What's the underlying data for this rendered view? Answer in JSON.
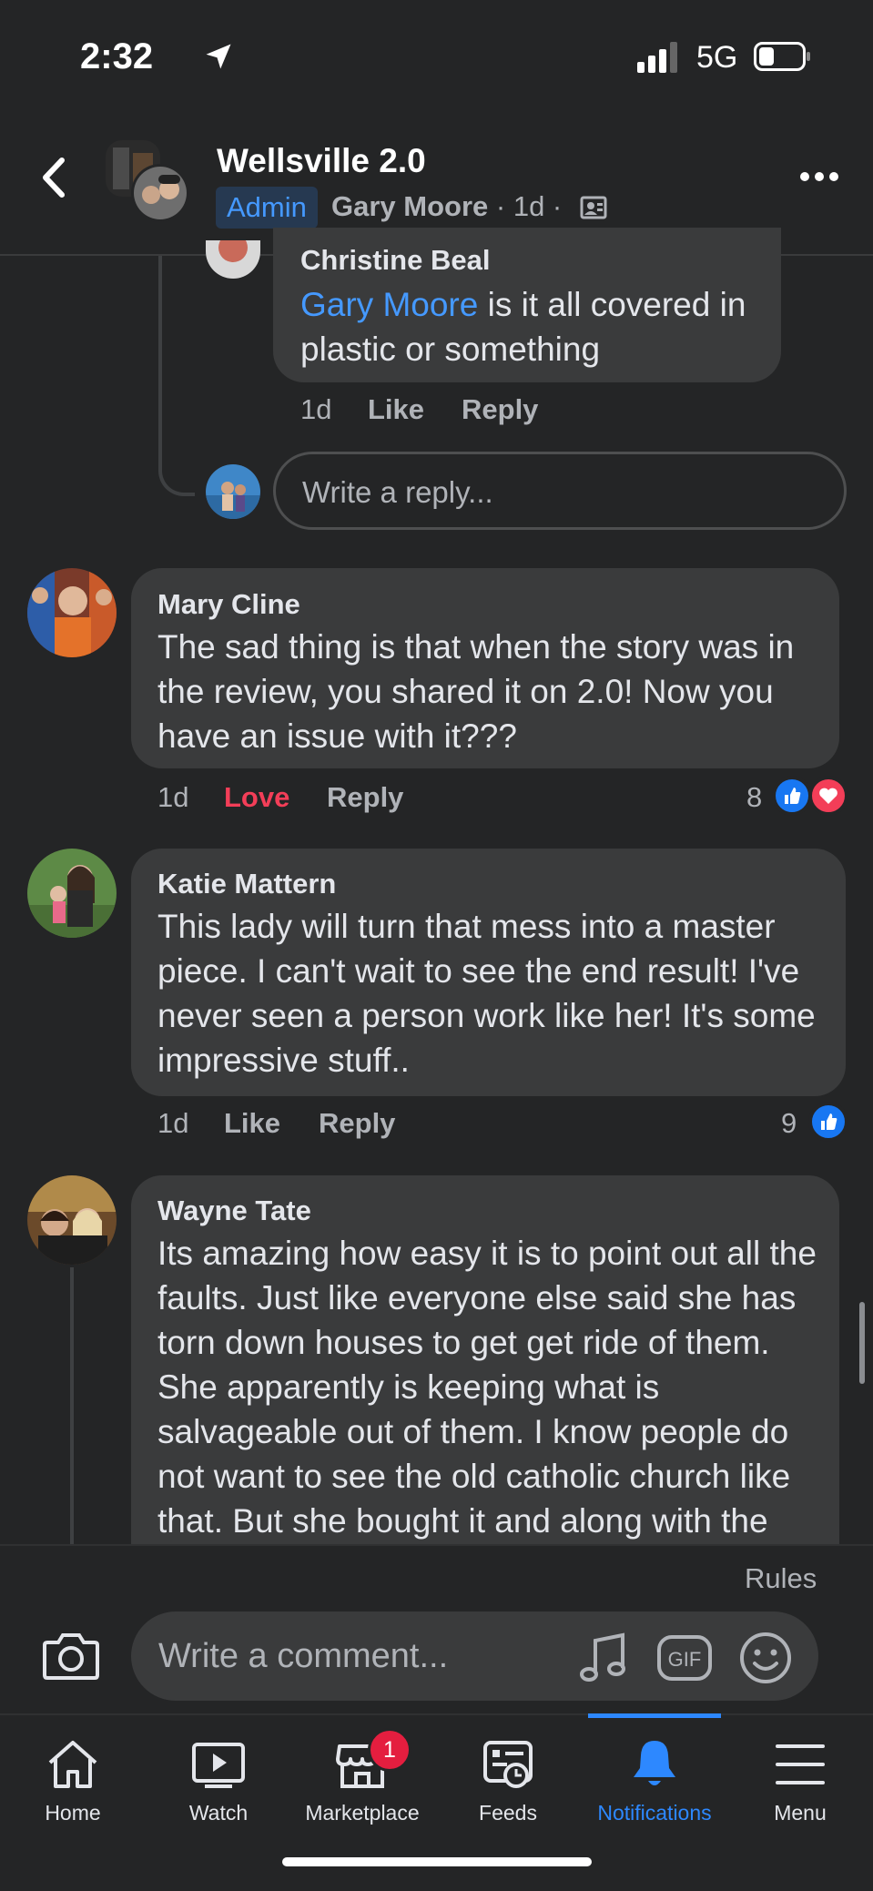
{
  "status": {
    "time": "2:32",
    "network": "5G"
  },
  "header": {
    "title": "Wellsville 2.0",
    "badge": "Admin",
    "author": "Gary Moore",
    "meta": " · 1d · "
  },
  "replies": [
    {
      "name": "Christine Beal",
      "mention": "Gary Moore",
      "text": " is it all covered in plastic or something",
      "time": "1d",
      "like": "Like",
      "reply": "Reply"
    }
  ],
  "reply_input": {
    "placeholder": "Write a reply..."
  },
  "comments": [
    {
      "name": "Mary Cline",
      "text": "The sad thing is that when the story was in the review, you shared it on 2.0! Now you have an issue with it???",
      "time": "1d",
      "like": "Love",
      "reply": "Reply",
      "reactions": "8"
    },
    {
      "name": "Katie Mattern",
      "text": "This lady will turn that mess into a master piece. I can't wait to see the end result! I've never seen a person work like her! It's some impressive stuff..",
      "time": "1d",
      "like": "Like",
      "reply": "Reply",
      "reactions": "9"
    },
    {
      "name": "Wayne Tate",
      "text": "Its amazing how easy it is to point out all the faults. Just like everyone else said she has torn down houses to get get ride of them. She apparently is keeping what is salvageable out of them. I know people do not want to see the old catholic church like that. But she bought it and along with the"
    }
  ],
  "composer": {
    "rules": "Rules",
    "placeholder": "Write a comment..."
  },
  "tabs": [
    {
      "label": "Home",
      "icon": "home-icon"
    },
    {
      "label": "Watch",
      "icon": "watch-icon"
    },
    {
      "label": "Marketplace",
      "icon": "marketplace-icon",
      "badge": "1"
    },
    {
      "label": "Feeds",
      "icon": "feeds-icon"
    },
    {
      "label": "Notifications",
      "icon": "bell-icon",
      "active": true
    },
    {
      "label": "Menu",
      "icon": "menu-icon"
    }
  ],
  "colors": {
    "accent": "#2d88ff",
    "love": "#f33e58",
    "bubble": "#3a3b3c",
    "background": "#242526"
  }
}
